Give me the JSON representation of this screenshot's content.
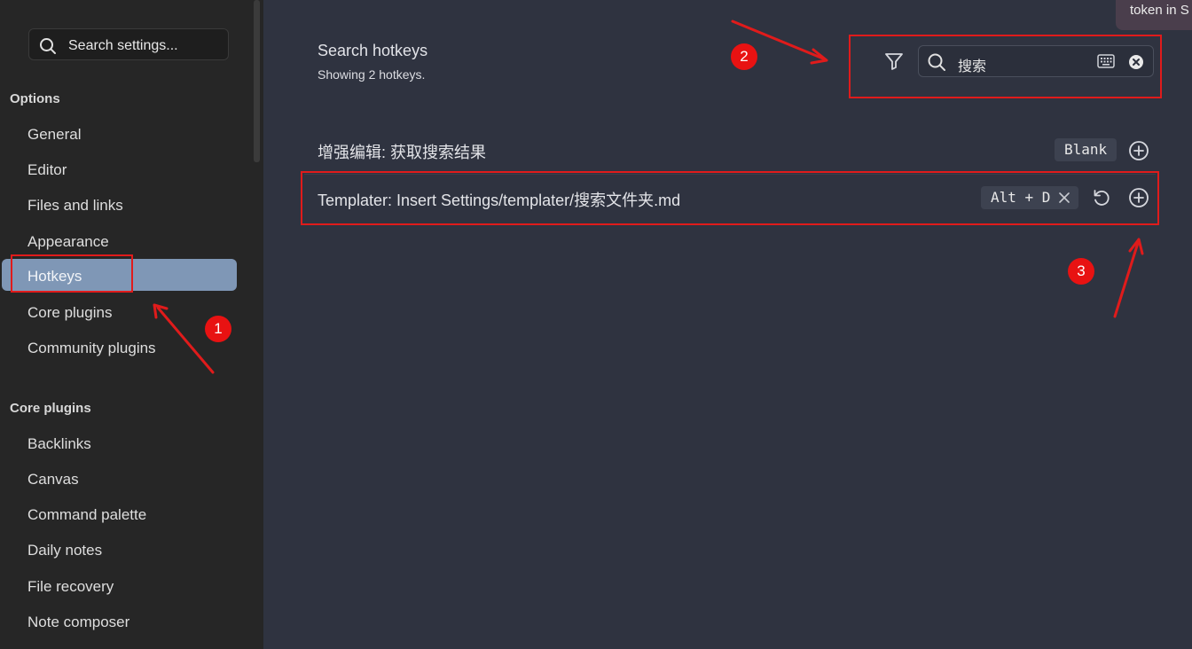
{
  "sidebar": {
    "search_placeholder": "Search settings...",
    "options_heading": "Options",
    "options": [
      "General",
      "Editor",
      "Files and links",
      "Appearance",
      "Hotkeys",
      "Core plugins",
      "Community plugins"
    ],
    "active": "Hotkeys",
    "core_heading": "Core plugins",
    "core_plugins": [
      "Backlinks",
      "Canvas",
      "Command palette",
      "Daily notes",
      "File recovery",
      "Note composer"
    ]
  },
  "main": {
    "title": "Search hotkeys",
    "subtitle": "Showing 2 hotkeys.",
    "search_value": "搜索",
    "hotkeys": [
      {
        "name": "增强编辑: 获取搜索结果",
        "keys": "Blank"
      },
      {
        "name": "Templater: Insert Settings/templater/搜索文件夹.md",
        "keys": "Alt + D"
      }
    ]
  },
  "tooltip": "token in S",
  "annotations": [
    "1",
    "2",
    "3"
  ],
  "colors": {
    "sidebar_bg": "#262626",
    "main_bg": "#2f3340",
    "active_item": "#7f97b6",
    "annotation_red": "#e01b1b"
  },
  "icons": [
    "search-icon",
    "filter-icon",
    "keyboard-icon",
    "clear-icon",
    "plus-circle-icon",
    "close-icon",
    "reset-icon"
  ]
}
